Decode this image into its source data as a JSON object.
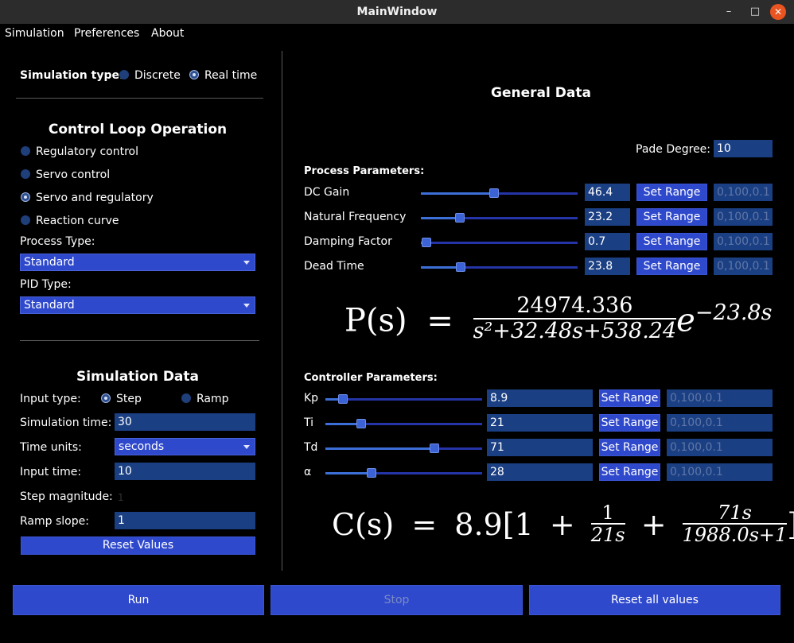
{
  "window": {
    "title": "MainWindow",
    "minimize_glyph": "–",
    "maximize_glyph": "□",
    "close_glyph": "✕"
  },
  "menu": [
    "Simulation",
    "Preferences",
    "About"
  ],
  "left": {
    "sim_type_label": "Simulation type:",
    "sim_type_options": [
      "Discrete",
      "Real time"
    ],
    "sim_type_selected": "Real time",
    "control_loop_heading": "Control Loop Operation",
    "control_loop_options": [
      "Regulatory control",
      "Servo control",
      "Servo and regulatory",
      "Reaction curve"
    ],
    "control_loop_selected": "Servo and regulatory",
    "process_type_label": "Process Type:",
    "process_type_value": "Standard",
    "pid_type_label": "PID Type:",
    "pid_type_value": "Standard",
    "sim_data_heading": "Simulation Data",
    "input_type_label": "Input type:",
    "input_type_options": [
      "Step",
      "Ramp"
    ],
    "input_type_selected": "Step",
    "sim_time_label": "Simulation time:",
    "sim_time_value": "30",
    "time_units_label": "Time units:",
    "time_units_value": "seconds",
    "input_time_label": "Input time:",
    "input_time_value": "10",
    "step_mag_label": "Step magnitude:",
    "step_mag_value": "1",
    "ramp_slope_label": "Ramp slope:",
    "ramp_slope_value": "1",
    "reset_values_label": "Reset Values"
  },
  "right": {
    "general_heading": "General Data",
    "pade_label": "Pade Degree:",
    "pade_value": "10",
    "process_heading": "Process Parameters:",
    "process_params": [
      {
        "label": "DC Gain",
        "value": "46.4",
        "range": "0,100,0.1",
        "slider": 0.464
      },
      {
        "label": "Natural Frequency",
        "value": "23.2",
        "range": "0,100,0.1",
        "slider": 0.232
      },
      {
        "label": "Damping Factor",
        "value": "0.7",
        "range": "0,100,0.1",
        "slider": 0.007
      },
      {
        "label": "Dead Time",
        "value": "23.8",
        "range": "0,100,0.1",
        "slider": 0.238
      }
    ],
    "set_range_label": "Set Range",
    "controller_heading": "Controller Parameters:",
    "controller_params": [
      {
        "label": "Kp",
        "value": "8.9",
        "range": "0,100,0.1",
        "slider": 0.089
      },
      {
        "label": "Ti",
        "value": "21",
        "range": "0,100,0.1",
        "slider": 0.21
      },
      {
        "label": "Td",
        "value": "71",
        "range": "0,100,0.1",
        "slider": 0.71
      },
      {
        "label": "α",
        "value": "28",
        "range": "0,100,0.1",
        "slider": 0.28
      }
    ],
    "process_eq": {
      "lhs": "P(s)",
      "eq": "=",
      "num": "24974.336",
      "den": "s²+32.48s+538.24",
      "exp_base": "e",
      "exp": "−23.8s"
    },
    "controller_eq": {
      "lhs": "C(s)",
      "eq": "=",
      "gain": "8.9",
      "open": "[",
      "one": "1",
      "plus": "+",
      "f1_num": "1",
      "f1_den": "21s",
      "f2_num": "71s",
      "f2_den": "1988.0s+1",
      "close": "]"
    }
  },
  "bottom": {
    "run": "Run",
    "stop": "Stop",
    "reset_all": "Reset all values"
  }
}
